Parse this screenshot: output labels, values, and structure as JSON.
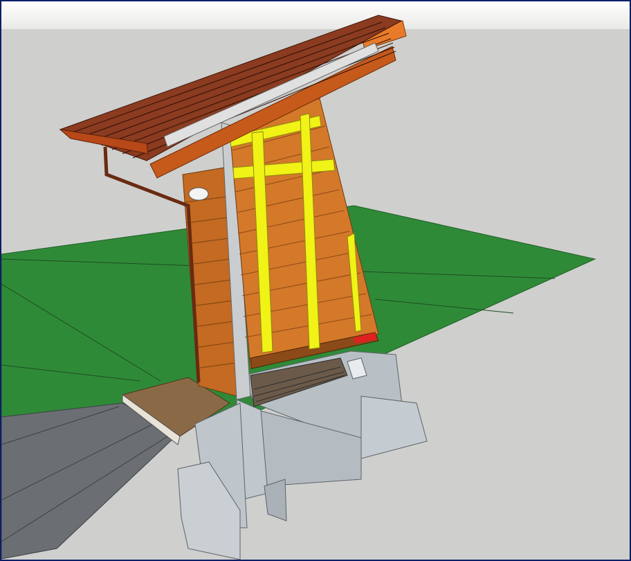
{
  "viewport": {
    "kind": "3d-model-view"
  },
  "colors": {
    "frame": "#0b1e66",
    "sky": "#ffffff",
    "ground_plane": "#cfcfcd",
    "grass": "#2f8a38",
    "road": "#6b6e72",
    "cladding": "#d4782a",
    "studs": "#f1f216",
    "roof": "#8b3b1f",
    "concrete": "#b8c0c6",
    "gravel": "#8a6a46"
  }
}
